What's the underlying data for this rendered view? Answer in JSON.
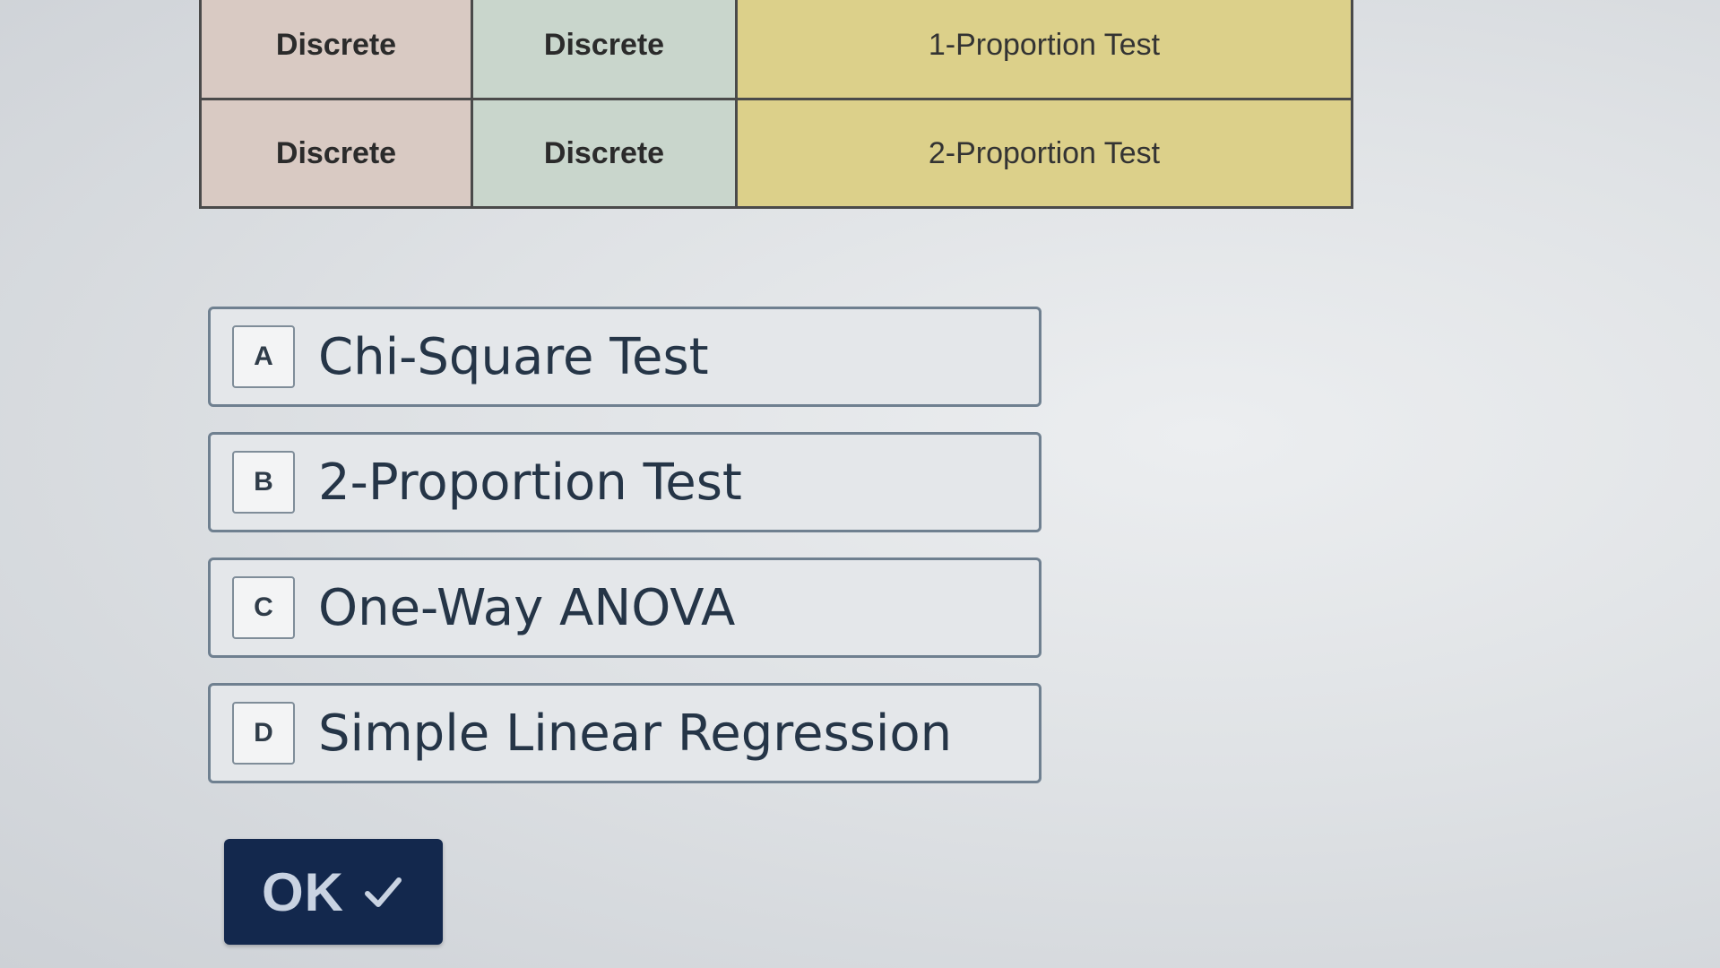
{
  "table": {
    "rows": [
      {
        "col1": "Discrete",
        "col2": "Discrete",
        "test": "1-Proportion Test"
      },
      {
        "col1": "Discrete",
        "col2": "Discrete",
        "test": "2-Proportion Test"
      }
    ]
  },
  "options": [
    {
      "key": "A",
      "label": "Chi-Square Test"
    },
    {
      "key": "B",
      "label": "2-Proportion Test"
    },
    {
      "key": "C",
      "label": "One-Way ANOVA"
    },
    {
      "key": "D",
      "label": "Simple Linear Regression"
    }
  ],
  "ok_button": {
    "label": "OK",
    "icon": "check-icon"
  },
  "colors": {
    "col1_bg": "#d9cac3",
    "col2_bg": "#c9d6cc",
    "test_bg": "#dcd08a",
    "ok_bg": "#13284d",
    "option_text": "#253547"
  }
}
